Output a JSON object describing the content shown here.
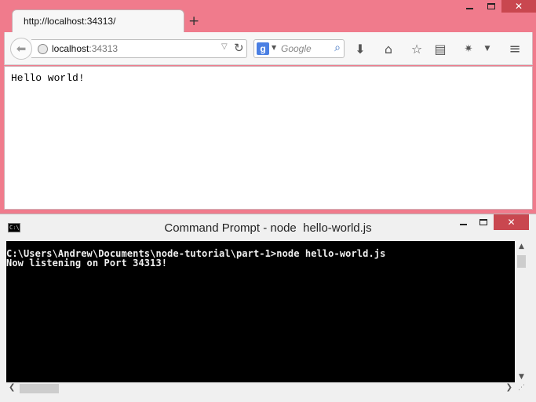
{
  "browser": {
    "tab_title": "http://localhost:34313/",
    "new_tab_glyph": "+",
    "url_host": "localhost",
    "url_port": ":34313",
    "search_placeholder": "Google",
    "page_text": "Hello world!",
    "icons": [
      "back-arrow-icon",
      "globe-icon",
      "dropdown-icon",
      "reload-icon",
      "google-logo-icon",
      "search-icon",
      "download-icon",
      "home-icon",
      "bookmark-star-icon",
      "reading-list-icon",
      "extension-icon",
      "menu-icon"
    ],
    "window_controls": {
      "minimize": "minimize-icon",
      "maximize": "maximize-icon",
      "close": "✕"
    }
  },
  "cmd": {
    "title": "Command Prompt - node  hello-world.js",
    "icon_text": "C:\\",
    "lines": [
      "C:\\Users\\Andrew\\Documents\\node-tutorial\\part-1>node hello-world.js",
      "Now listening on Port 34313!"
    ],
    "window_controls": {
      "close": "✕"
    }
  },
  "colors": {
    "browser_frame": "#f07b8c",
    "console_bg": "#000000",
    "console_fg": "#f0f0f0",
    "close_button": "#c9474f"
  }
}
